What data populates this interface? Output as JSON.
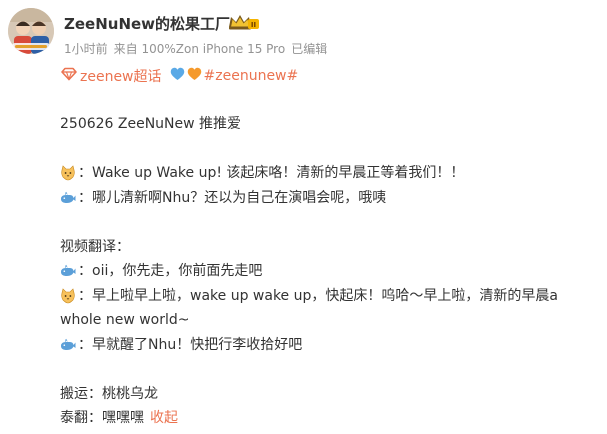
{
  "header": {
    "username": "ZeeNuNew的松果工厂",
    "timestamp": "1小时前",
    "source": "来自 100%Zon iPhone 15 Pro",
    "edited": "已编辑",
    "vip_level_text": "II"
  },
  "topics": {
    "super_topic": "zeenew超话",
    "hashtag": "#zeenunew#"
  },
  "content": {
    "line1": "250626  ZeeNuNew 推推爱",
    "line2": "：Wake up Wake up! 该起床咯！清新的早晨正等着我们！！",
    "line3": "：哪儿清新啊Nhu？还以为自己在演唱会呢，哦咦",
    "line4": "视频翻译：",
    "line5": "：oii，你先走，你前面先走吧",
    "line6": "：早上啦早上啦，wake up wake up，快起床！呜哈～早上啦，清新的早晨a",
    "line7": "whole new world~",
    "line8": "：早就醒了Nhu！快把行李收拾好吧",
    "line9": "搬运：桃桃乌龙",
    "line10_prefix": "泰翻：嘿嘿嘿",
    "collapse": "收起"
  },
  "colors": {
    "accent": "#eb7350",
    "text": "#333333",
    "meta": "#939393",
    "heart_blue": "#5aa9e6",
    "heart_orange": "#f59a2c"
  },
  "icons": {
    "cat_emoji": "cat-face-icon",
    "whale_emoji": "whale-icon",
    "super_topic": "diamond-topic-icon",
    "vip": "crown-badge-icon"
  }
}
